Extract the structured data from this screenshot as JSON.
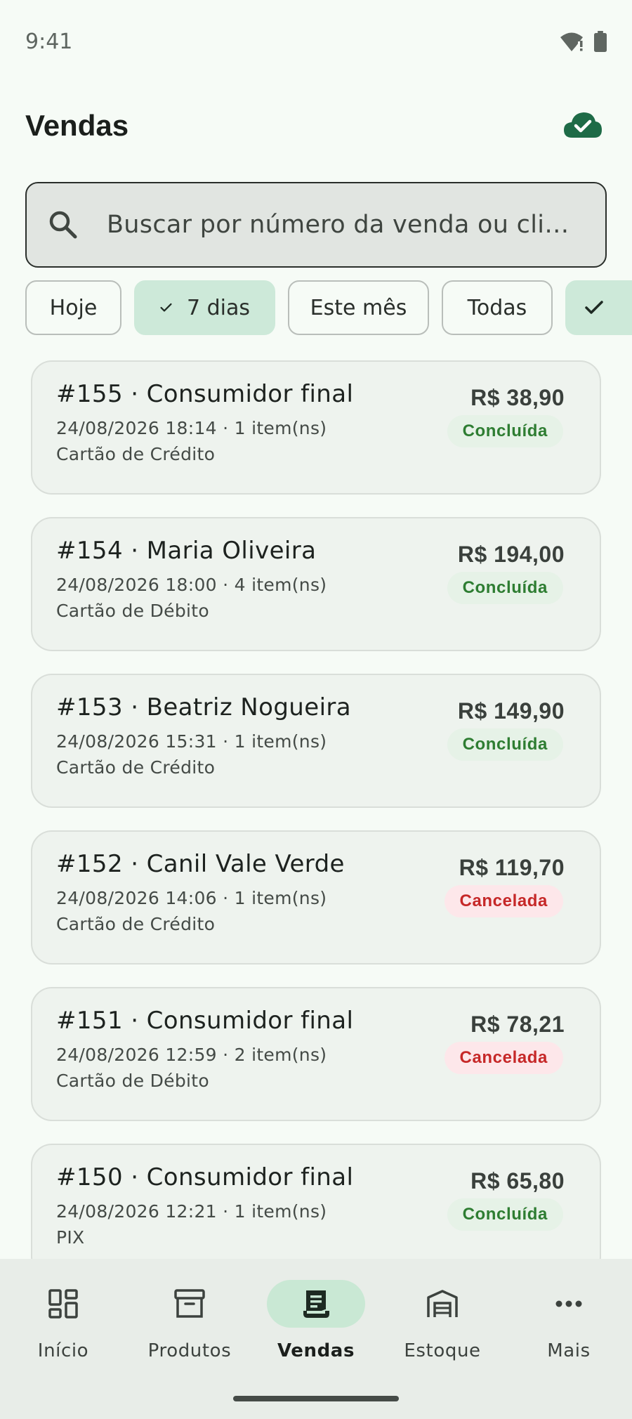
{
  "status_bar": {
    "time": "9:41"
  },
  "header": {
    "title": "Vendas"
  },
  "search": {
    "placeholder": "Buscar por número da venda ou cliente…"
  },
  "filters": [
    {
      "label": "Hoje",
      "selected": false
    },
    {
      "label": "7 dias",
      "selected": true
    },
    {
      "label": "Este mês",
      "selected": false
    },
    {
      "label": "Todas",
      "selected": false
    }
  ],
  "sales": [
    {
      "title": "#155 · Consumidor final",
      "meta": "24/08/2026 18:14 · 1 item(ns)",
      "payment": "Cartão de Crédito",
      "amount": "R$ 38,90",
      "status": "Concluída",
      "status_type": "done"
    },
    {
      "title": "#154 · Maria Oliveira",
      "meta": "24/08/2026 18:00 · 4 item(ns)",
      "payment": "Cartão de Débito",
      "amount": "R$ 194,00",
      "status": "Concluída",
      "status_type": "done"
    },
    {
      "title": "#153 · Beatriz Nogueira",
      "meta": "24/08/2026 15:31 · 1 item(ns)",
      "payment": "Cartão de Crédito",
      "amount": "R$ 149,90",
      "status": "Concluída",
      "status_type": "done"
    },
    {
      "title": "#152 · Canil Vale Verde",
      "meta": "24/08/2026 14:06 · 1 item(ns)",
      "payment": "Cartão de Crédito",
      "amount": "R$ 119,70",
      "status": "Cancelada",
      "status_type": "canceled"
    },
    {
      "title": "#151 · Consumidor final",
      "meta": "24/08/2026 12:59 · 2 item(ns)",
      "payment": "Cartão de Débito",
      "amount": "R$ 78,21",
      "status": "Cancelada",
      "status_type": "canceled"
    },
    {
      "title": "#150 · Consumidor final",
      "meta": "24/08/2026 12:21 · 1 item(ns)",
      "payment": "PIX",
      "amount": "R$ 65,80",
      "status": "Concluída",
      "status_type": "done"
    }
  ],
  "bottom_nav": [
    {
      "label": "Início",
      "icon": "dashboard-icon",
      "active": false
    },
    {
      "label": "Produtos",
      "icon": "archive-box-icon",
      "active": false
    },
    {
      "label": "Vendas",
      "icon": "receipt-icon",
      "active": true
    },
    {
      "label": "Estoque",
      "icon": "warehouse-icon",
      "active": false
    },
    {
      "label": "Mais",
      "icon": "more-horizontal-icon",
      "active": false
    }
  ],
  "colors": {
    "background": "#f6fbf6",
    "accent": "#1e6b47",
    "status_done": "#2e7d32",
    "status_canceled": "#c62828",
    "chip_selected": "#cde9d9"
  }
}
